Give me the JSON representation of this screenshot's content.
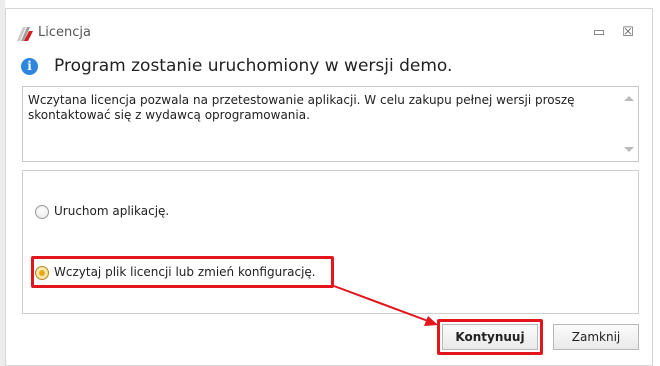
{
  "window": {
    "title": "Licencja",
    "minimize_icon": "minimize-icon",
    "close_icon": "close-icon",
    "minimize_glyph": "▭",
    "close_glyph": "☒"
  },
  "header": {
    "icon": "info-icon",
    "icon_glyph": "i",
    "text": "Program zostanie uruchomiony w wersji demo."
  },
  "message": {
    "text": "Wczytana licencja pozwala na przetestowanie aplikacji. W celu zakupu pełnej wersji proszę skontaktować się z wydawcą oprogramowania."
  },
  "options": [
    {
      "label": "Uruchom aplikację.",
      "selected": false
    },
    {
      "label": "Wczytaj plik licencji lub zmień konfigurację.",
      "selected": true
    }
  ],
  "buttons": {
    "continue_label": "Kontynuuj",
    "close_label": "Zamknij"
  },
  "colors": {
    "highlight": "#e3151d",
    "info_icon": "#2e86de",
    "radio_selected": "#e6a817"
  }
}
